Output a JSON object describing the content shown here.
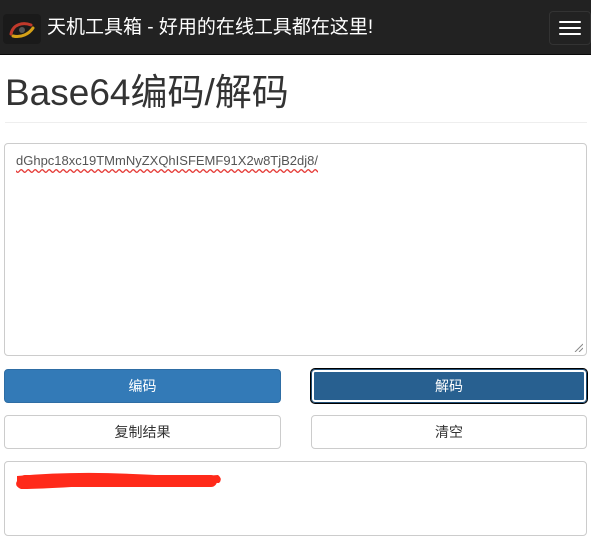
{
  "navbar": {
    "title": "天机工具箱 - 好用的在线工具都在这里!",
    "logo_icon": "brand-logo-icon",
    "menu_icon": "hamburger-menu-icon",
    "background": "#222222"
  },
  "page": {
    "title": "Base64编码/解码"
  },
  "input": {
    "value": "dGhpc18xc19TMmNyZXQhISFEMF91X2w8TjB2dj8/"
  },
  "buttons": {
    "encode_label": "编码",
    "decode_label": "解码",
    "copy_label": "复制结果",
    "clear_label": "清空"
  },
  "colors": {
    "primary": "#337ab7",
    "primary_active": "#286090",
    "redaction": "#ff2a1a"
  }
}
